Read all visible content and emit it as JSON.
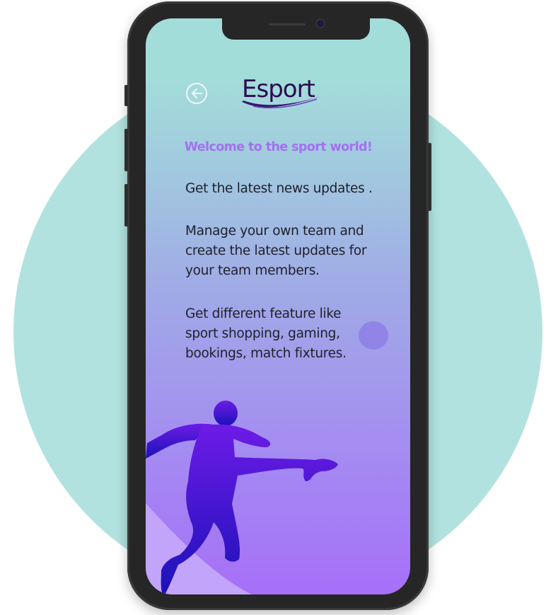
{
  "app": {
    "logo_text": "Esport",
    "back_button_icon": "left-arrow-circle-icon"
  },
  "content": {
    "welcome": "Welcome to the sport world!",
    "paragraphs": [
      "Get the latest news updates .",
      "Manage your own team and create the latest updates for your team members.",
      "Get different feature like sport shopping, gaming, bookings, match fixtures."
    ]
  },
  "colors": {
    "background_circle": "#b2e2df",
    "phone_frame": "#262626",
    "screen_top": "#a3ddd9",
    "screen_bottom": "#a66ff8",
    "welcome_text": "#a570f2",
    "logo_text": "#2a0c4e",
    "player_silhouette": "#4b16d6"
  },
  "illustration": {
    "name": "football-player-kick-silhouette"
  }
}
